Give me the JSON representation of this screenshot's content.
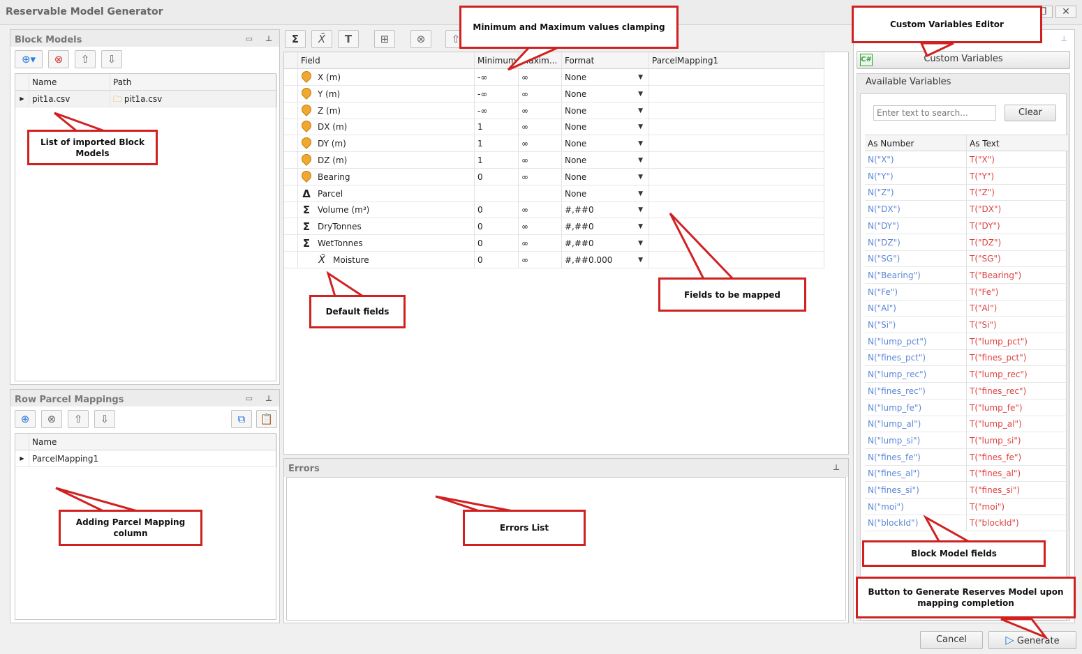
{
  "window": {
    "title": "Reservable Model Generator",
    "restore_glyph": "❐",
    "close_glyph": "✕"
  },
  "block_models": {
    "title": "Block Models",
    "columns": [
      "Name",
      "Path"
    ],
    "rows": [
      {
        "name": "pit1a.csv",
        "path": "pit1a.csv"
      }
    ]
  },
  "row_parcel": {
    "title": "Row Parcel Mappings",
    "columns": [
      "Name"
    ],
    "rows": [
      {
        "name": "ParcelMapping1"
      }
    ]
  },
  "fields": {
    "columns": [
      "Field",
      "Minimum",
      "Maxim...",
      "Format",
      "ParcelMapping1"
    ],
    "rows": [
      {
        "icon": "location-pin-icon",
        "field": "X (m)",
        "min": "-∞",
        "max": "∞",
        "format": "None"
      },
      {
        "icon": "location-pin-icon",
        "field": "Y (m)",
        "min": "-∞",
        "max": "∞",
        "format": "None"
      },
      {
        "icon": "location-pin-icon",
        "field": "Z (m)",
        "min": "-∞",
        "max": "∞",
        "format": "None"
      },
      {
        "icon": "location-pin-icon",
        "field": "DX (m)",
        "min": "1",
        "max": "∞",
        "format": "None"
      },
      {
        "icon": "location-pin-icon",
        "field": "DY (m)",
        "min": "1",
        "max": "∞",
        "format": "None"
      },
      {
        "icon": "location-pin-icon",
        "field": "DZ (m)",
        "min": "1",
        "max": "∞",
        "format": "None"
      },
      {
        "icon": "location-pin-icon",
        "field": "Bearing",
        "min": "0",
        "max": "∞",
        "format": "None"
      },
      {
        "icon": "delta-icon",
        "field": "Parcel",
        "min": "",
        "max": "",
        "format": "None"
      },
      {
        "icon": "sigma-icon",
        "field": "Volume (m³)",
        "min": "0",
        "max": "∞",
        "format": "#,##0"
      },
      {
        "icon": "sigma-icon",
        "field": "DryTonnes",
        "min": "0",
        "max": "∞",
        "format": "#,##0"
      },
      {
        "icon": "sigma-icon",
        "field": "WetTonnes",
        "min": "0",
        "max": "∞",
        "format": "#,##0"
      },
      {
        "icon": "weighted-average-icon",
        "field": "Moisture",
        "min": "0",
        "max": "∞",
        "format": "#,##0.000"
      }
    ]
  },
  "errors": {
    "title": "Errors"
  },
  "custom_vars": {
    "button_label": "Custom Variables",
    "available_title": "Available Variables",
    "search_placeholder": "Enter text to search...",
    "clear_label": "Clear",
    "columns": [
      "As Number",
      "As Text"
    ],
    "rows": [
      [
        "N(\"X\")",
        "T(\"X\")"
      ],
      [
        "N(\"Y\")",
        "T(\"Y\")"
      ],
      [
        "N(\"Z\")",
        "T(\"Z\")"
      ],
      [
        "N(\"DX\")",
        "T(\"DX\")"
      ],
      [
        "N(\"DY\")",
        "T(\"DY\")"
      ],
      [
        "N(\"DZ\")",
        "T(\"DZ\")"
      ],
      [
        "N(\"SG\")",
        "T(\"SG\")"
      ],
      [
        "N(\"Bearing\")",
        "T(\"Bearing\")"
      ],
      [
        "N(\"Fe\")",
        "T(\"Fe\")"
      ],
      [
        "N(\"Al\")",
        "T(\"Al\")"
      ],
      [
        "N(\"Si\")",
        "T(\"Si\")"
      ],
      [
        "N(\"lump_pct\")",
        "T(\"lump_pct\")"
      ],
      [
        "N(\"fines_pct\")",
        "T(\"fines_pct\")"
      ],
      [
        "N(\"lump_rec\")",
        "T(\"lump_rec\")"
      ],
      [
        "N(\"fines_rec\")",
        "T(\"fines_rec\")"
      ],
      [
        "N(\"lump_fe\")",
        "T(\"lump_fe\")"
      ],
      [
        "N(\"lump_al\")",
        "T(\"lump_al\")"
      ],
      [
        "N(\"lump_si\")",
        "T(\"lump_si\")"
      ],
      [
        "N(\"fines_fe\")",
        "T(\"fines_fe\")"
      ],
      [
        "N(\"fines_al\")",
        "T(\"fines_al\")"
      ],
      [
        "N(\"fines_si\")",
        "T(\"fines_si\")"
      ],
      [
        "N(\"moi\")",
        "T(\"moi\")"
      ],
      [
        "N(\"blockId\")",
        "T(\"blockId\")"
      ]
    ]
  },
  "footer": {
    "cancel_label": "Cancel",
    "generate_label": "Generate"
  },
  "callouts": {
    "clamping": "Minimum and Maximum values clamping",
    "custom_editor": "Custom Variables Editor",
    "imported": "List of imported Block Models",
    "fields_mapped": "Fields to be mapped",
    "default_fields": "Default fields",
    "adding_parcel": "Adding Parcel Mapping column",
    "errors_list": "Errors List",
    "block_model_fields": "Block Model fields",
    "generate_button": "Button to Generate Reserves Model upon mapping completion"
  },
  "colors": {
    "callout_border": "#d12020",
    "number_var": "#5b87d6",
    "text_var": "#e04040"
  }
}
